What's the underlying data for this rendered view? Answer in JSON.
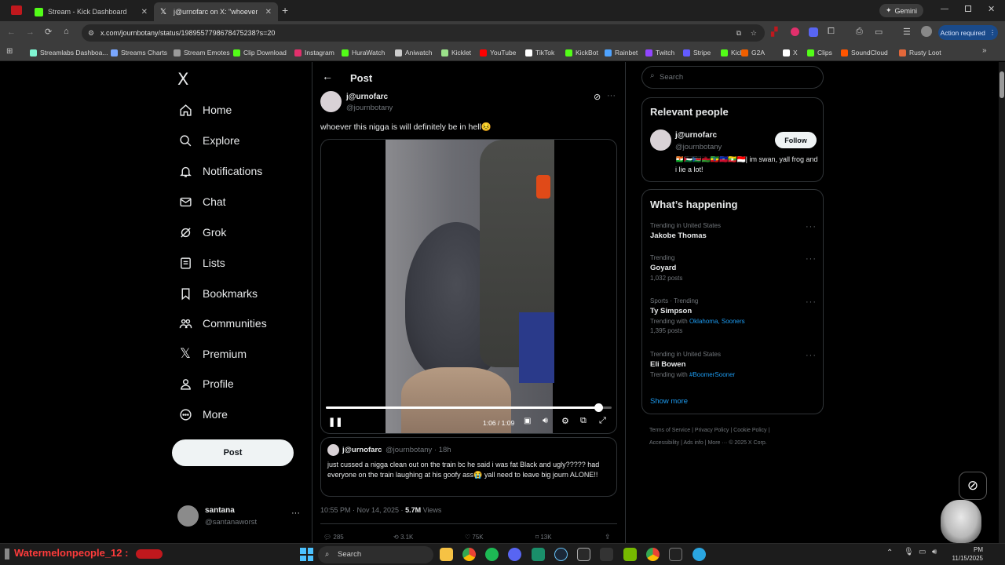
{
  "browser": {
    "tabs": [
      {
        "title": "Stream - Kick Dashboard",
        "favicon_color": "#53fc18"
      },
      {
        "title": "j@urnofarc on X: \"whoever",
        "favicon_color": "#ffffff"
      }
    ],
    "gemini_label": "Gemini",
    "url": "x.com/journbotany/status/1989557798678475238?s=20",
    "action_required": "Action required",
    "bookmarks": [
      {
        "label": "Streamlabs Dashboa...",
        "color": "#80f5d2"
      },
      {
        "label": "Streams Charts",
        "color": "#7aa7ff"
      },
      {
        "label": "Stream Emotes",
        "color": "#9b9b9b"
      },
      {
        "label": "Clip Download",
        "color": "#53fc18"
      },
      {
        "label": "Instagram",
        "color": "#e1306c"
      },
      {
        "label": "HuraWatch",
        "color": "#53fc18"
      },
      {
        "label": "Aniwatch",
        "color": "#cccccc"
      },
      {
        "label": "Kicklet",
        "color": "#9be28a"
      },
      {
        "label": "YouTube",
        "color": "#ff0000"
      },
      {
        "label": "TikTok",
        "color": "#ffffff"
      },
      {
        "label": "KickBot",
        "color": "#53fc18"
      },
      {
        "label": "Rainbet",
        "color": "#4fa3ff"
      },
      {
        "label": "Twitch",
        "color": "#9146ff"
      },
      {
        "label": "Stripe",
        "color": "#635bff"
      },
      {
        "label": "Kick",
        "color": "#53fc18"
      },
      {
        "label": "G2A",
        "color": "#f05f00"
      },
      {
        "label": "X",
        "color": "#ffffff"
      },
      {
        "label": "Clips",
        "color": "#53fc18"
      },
      {
        "label": "SoundCloud",
        "color": "#ff5500"
      },
      {
        "label": "Rusty Loot",
        "color": "#e2673a"
      }
    ]
  },
  "nav": {
    "logo": "X",
    "items": [
      {
        "label": "Home",
        "icon": "home-icon"
      },
      {
        "label": "Explore",
        "icon": "search-icon"
      },
      {
        "label": "Notifications",
        "icon": "bell-icon"
      },
      {
        "label": "Chat",
        "icon": "mail-icon"
      },
      {
        "label": "Grok",
        "icon": "grok-icon"
      },
      {
        "label": "Lists",
        "icon": "list-icon"
      },
      {
        "label": "Bookmarks",
        "icon": "bookmark-icon"
      },
      {
        "label": "Communities",
        "icon": "people-icon"
      },
      {
        "label": "Premium",
        "icon": "x-icon"
      },
      {
        "label": "Profile",
        "icon": "person-icon"
      },
      {
        "label": "More",
        "icon": "more-circle-icon"
      }
    ],
    "post_button": "Post",
    "account": {
      "name": "santana",
      "handle": "@santanaworst"
    }
  },
  "post": {
    "header": "Post",
    "author_name": "j@urnofarc",
    "author_handle": "@journbotany",
    "text": "whoever this nigga is will definitely be in hell😣",
    "video": {
      "time": "1:06 / 1:09",
      "progress": 0.952
    },
    "quote": {
      "author_name": "j@urnofarc",
      "meta": "@journbotany · 18h",
      "text": "just cussed a nigga clean out on the train bc he said i was fat Black and ugly????? had everyone on the train laughing at his goofy ass😭 yall need to leave big journ ALONE!!"
    },
    "timestamp": "10:55 PM · Nov 14, 2025 · ",
    "views_count": "5.7M",
    "views_label": " Views",
    "actions": {
      "replies": "285",
      "reposts": "3.1K",
      "likes": "75K",
      "bookmarks": "13K"
    }
  },
  "sidebar": {
    "search_placeholder": "Search",
    "relevant_title": "Relevant people",
    "person": {
      "name": "j@urnofarc",
      "handle": "@journbotany",
      "follow": "Follow",
      "bio": "🇳🇪🇵🇸🇸🇸🇲🇼🇪🇹🇭🇹🇲🇲🇮🇩| im swan, yall frog and i lie a lot!"
    },
    "happening_title": "What’s happening",
    "trends": [
      {
        "category": "Trending in United States",
        "name": "Jakobe Thomas",
        "sub": "",
        "sub_link": ""
      },
      {
        "category": "Trending",
        "name": "Goyard",
        "sub": "1,032 posts",
        "sub_link": ""
      },
      {
        "category": "Sports · Trending",
        "name": "Ty Simpson",
        "sub": "Trending with ",
        "sub_link": "Oklahoma, Sooners",
        "sub2": "1,395 posts"
      },
      {
        "category": "Trending in United States",
        "name": "Eli Bowen",
        "sub": "Trending with ",
        "sub_link": "#BoomerSooner"
      }
    ],
    "show_more": "Show more",
    "footer": [
      "Terms of Service",
      "Privacy Policy",
      "Cookie Policy",
      "Accessibility",
      "Ads info",
      "More ···",
      "© 2025 X Corp."
    ]
  },
  "taskbar": {
    "stream_user": "Watermelonpeople_12 :",
    "search": "Search",
    "time": "PM",
    "date": "11/15/2025"
  }
}
